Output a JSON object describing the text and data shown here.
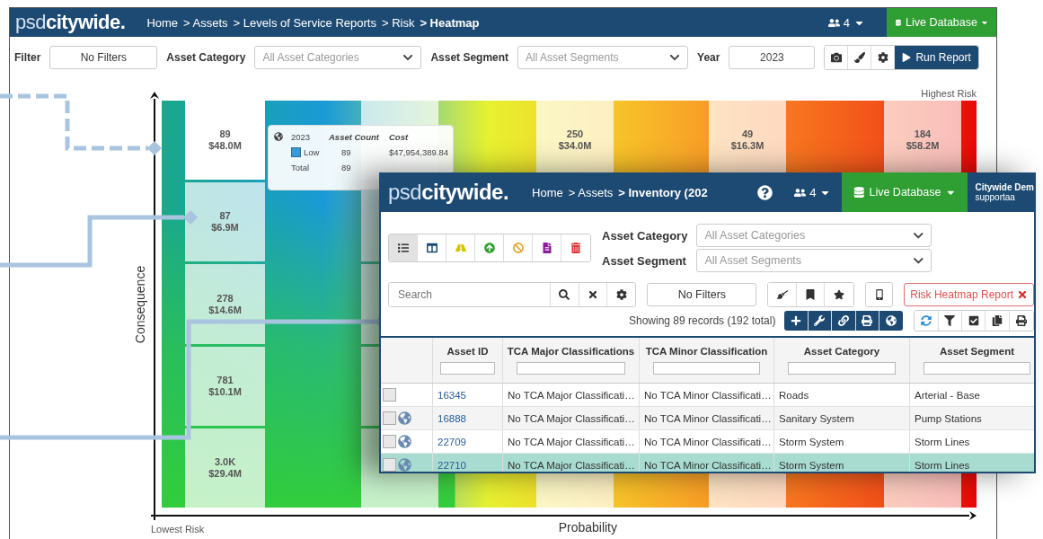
{
  "back_window": {
    "logo": {
      "prefix": "psd",
      "name": "citywide."
    },
    "breadcrumbs": [
      {
        "label": "Home",
        "current": false
      },
      {
        "label": "> Assets",
        "current": false
      },
      {
        "label": "> Levels of Service Reports",
        "current": false
      },
      {
        "label": "> Risk",
        "current": false
      },
      {
        "label": "> Heatmap",
        "current": true
      }
    ],
    "user_count": "4",
    "database_button": "Live Database",
    "filter_bar": {
      "filter_label": "Filter",
      "filter_button": "No Filters",
      "category_label": "Asset Category",
      "category_placeholder": "All Asset Categories",
      "segment_label": "Asset Segment",
      "segment_placeholder": "All Asset Segments",
      "year_label": "Year",
      "year_value": "2023",
      "run_button": "Run Report"
    },
    "heatmap": {
      "y_axis_label": "Consequence",
      "x_axis_label": "Probability",
      "low_label": "Lowest Risk",
      "high_label": "Highest Risk",
      "columns": [
        {
          "kind": "values",
          "cells": [
            {
              "count": "89",
              "cost": "$48.0M",
              "selected": true
            },
            {
              "count": "87",
              "cost": "$6.9M",
              "selected": false
            },
            {
              "count": "278",
              "cost": "$14.6M",
              "selected": false
            },
            {
              "count": "781",
              "cost": "$10.1M",
              "selected": false
            },
            {
              "count": "3.0K",
              "cost": "$29.4M",
              "selected": false
            }
          ]
        },
        {
          "kind": "blank"
        },
        {
          "kind": "values",
          "cells": [
            {
              "count": "250",
              "cost": "$34.0M",
              "selected": false
            }
          ]
        },
        {
          "kind": "values",
          "cells": [
            {
              "count": "49",
              "cost": "$16.3M",
              "selected": false
            }
          ]
        },
        {
          "kind": "values",
          "cells": [
            {
              "count": "184",
              "cost": "$58.2M",
              "selected": false
            }
          ]
        }
      ],
      "tooltip": {
        "year": "2023",
        "count_heading": "Asset Count",
        "cost_heading": "Cost",
        "rows": [
          {
            "label": "Low",
            "count": "89",
            "cost": "$47,954,389.84",
            "color": "#3a9ad9"
          },
          {
            "label": "Total",
            "count": "89"
          }
        ]
      }
    }
  },
  "front_window": {
    "logo": {
      "prefix": "psd",
      "name": "citywide."
    },
    "breadcrumbs": [
      {
        "label": "Home",
        "current": false
      },
      {
        "label": "> Assets",
        "current": false
      },
      {
        "label": "> Inventory (202",
        "current": true
      }
    ],
    "user_count": "4",
    "database_button": "Live Database",
    "account_name": "Citywide Dem",
    "account_user": "supportaa",
    "view_toolbar": [
      {
        "selected": true
      },
      {
        "selected": false
      },
      {
        "selected": false
      },
      {
        "selected": false
      },
      {
        "selected": false
      },
      {
        "selected": false
      },
      {
        "selected": false
      }
    ],
    "category_label": "Asset Category",
    "category_placeholder": "All Asset Categories",
    "segment_label": "Asset Segment",
    "segment_placeholder": "All Asset Segments",
    "search_placeholder": "Search",
    "filter_button": "No Filters",
    "report_button": "Risk Heatmap Report",
    "records_summary": "Showing 89 records (192 total)",
    "table": {
      "columns": [
        {
          "label": "Asset ID"
        },
        {
          "label": "TCA Major Classifications"
        },
        {
          "label": "TCA Minor Classification"
        },
        {
          "label": "Asset Category"
        },
        {
          "label": "Asset Segment"
        }
      ],
      "rows": [
        {
          "checked": false,
          "mapped": false,
          "selected": false,
          "cells": [
            "16345",
            "No TCA Major Classificati…",
            "No TCA Minor Classificati…",
            "Roads",
            "Arterial - Base"
          ]
        },
        {
          "checked": false,
          "mapped": true,
          "selected": false,
          "cells": [
            "16888",
            "No TCA Major Classificati…",
            "No TCA Minor Classificati…",
            "Sanitary System",
            "Pump Stations"
          ]
        },
        {
          "checked": false,
          "mapped": true,
          "selected": false,
          "cells": [
            "22709",
            "No TCA Major Classificati…",
            "No TCA Minor Classificati…",
            "Storm System",
            "Storm Lines"
          ]
        },
        {
          "checked": false,
          "mapped": true,
          "selected": true,
          "cells": [
            "22710",
            "No TCA Major Classificati…",
            "No TCA Minor Classificati…",
            "Storm System",
            "Storm Lines"
          ]
        }
      ]
    }
  }
}
